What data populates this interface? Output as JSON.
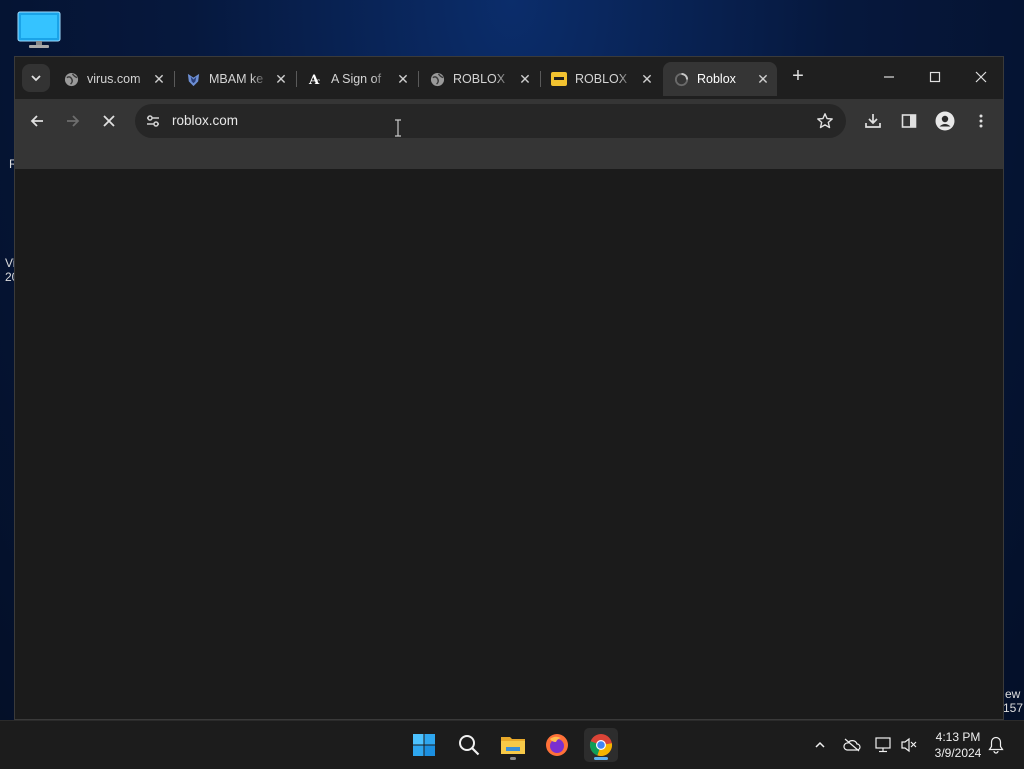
{
  "desktop": {
    "icon": "this-pc-icon",
    "edge_fragments": [
      "R",
      "Vi",
      "20"
    ],
    "right_fragments": [
      "ew",
      "157"
    ]
  },
  "browser": {
    "tabs": [
      {
        "title": "virus.com",
        "icon": "globe-icon"
      },
      {
        "title": "MBAM ke",
        "icon": "malwarebytes-icon"
      },
      {
        "title": "A Sign of",
        "icon": "typeface-icon"
      },
      {
        "title": "ROBLOX",
        "icon": "globe-icon"
      },
      {
        "title": "ROBLOX",
        "icon": "yellow-tab-icon"
      },
      {
        "title": "Roblox",
        "icon": "loading-icon",
        "active": true
      }
    ],
    "new_tab": "+",
    "address": {
      "url": "roblox.com"
    },
    "accent": "#5fb2f2"
  },
  "taskbar": {
    "apps": [
      "start-icon",
      "search-icon",
      "file-explorer-icon",
      "firefox-icon",
      "chrome-icon"
    ],
    "clock": {
      "time": "4:13 PM",
      "date": "3/9/2024"
    }
  }
}
